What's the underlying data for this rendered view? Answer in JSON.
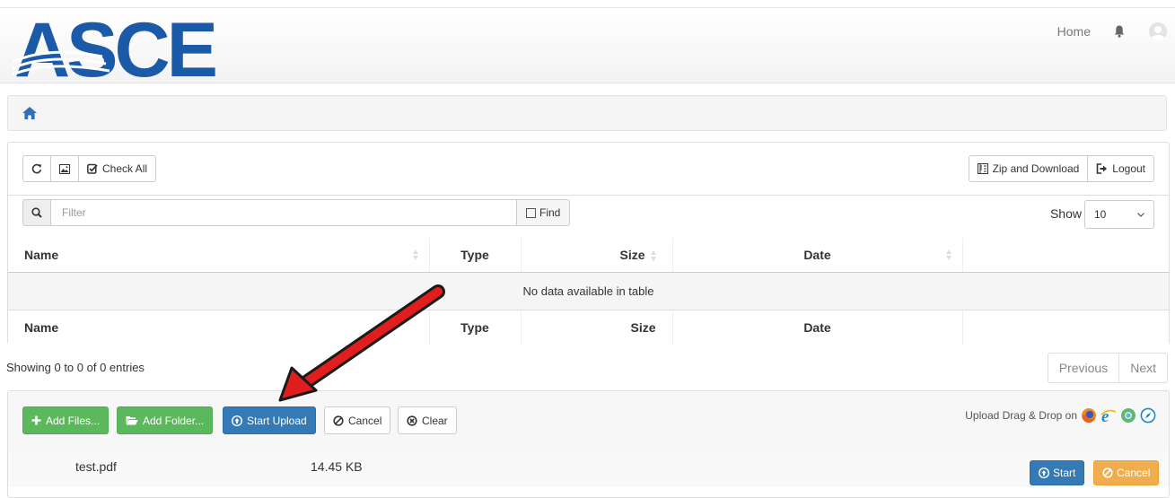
{
  "header": {
    "logo_text": "ASCE",
    "nav_home": "Home",
    "bell_icon": "bell-icon",
    "avatar_icon": "user-avatar-icon"
  },
  "breadcrumb": {
    "home_icon": "home-icon"
  },
  "toolbar": {
    "refresh_icon": "refresh-icon",
    "image_icon": "image-icon",
    "check_all": "Check All",
    "zip_download": "Zip and Download",
    "logout": "Logout"
  },
  "search": {
    "placeholder": "Filter",
    "value": "",
    "find_label": "Find",
    "show_label": "Show",
    "show_value": "10"
  },
  "table": {
    "columns": [
      "Name",
      "Type",
      "Size",
      "Date",
      ""
    ],
    "empty_message": "No data available in table",
    "footer_columns": [
      "Name",
      "Type",
      "Size",
      "Date",
      ""
    ]
  },
  "pagination": {
    "info": "Showing 0 to 0 of 0 entries",
    "previous": "Previous",
    "next": "Next"
  },
  "upload": {
    "add_files": "Add Files...",
    "add_folder": "Add Folder...",
    "start_upload": "Start Upload",
    "cancel": "Cancel",
    "clear": "Clear",
    "drag_drop_text": "Upload Drag & Drop on",
    "browser_icons": [
      "firefox-icon",
      "ie-icon",
      "chrome-icon",
      "safari-icon"
    ],
    "files": [
      {
        "name": "test.pdf",
        "size": "14.45 KB",
        "start": "Start",
        "cancel": "Cancel"
      }
    ]
  },
  "colors": {
    "brand_blue": "#1b5aa8",
    "btn_primary": "#337ab7",
    "btn_success": "#5cb85c",
    "btn_warning": "#f0ad4e",
    "annotation_arrow": "#e11d1d"
  }
}
